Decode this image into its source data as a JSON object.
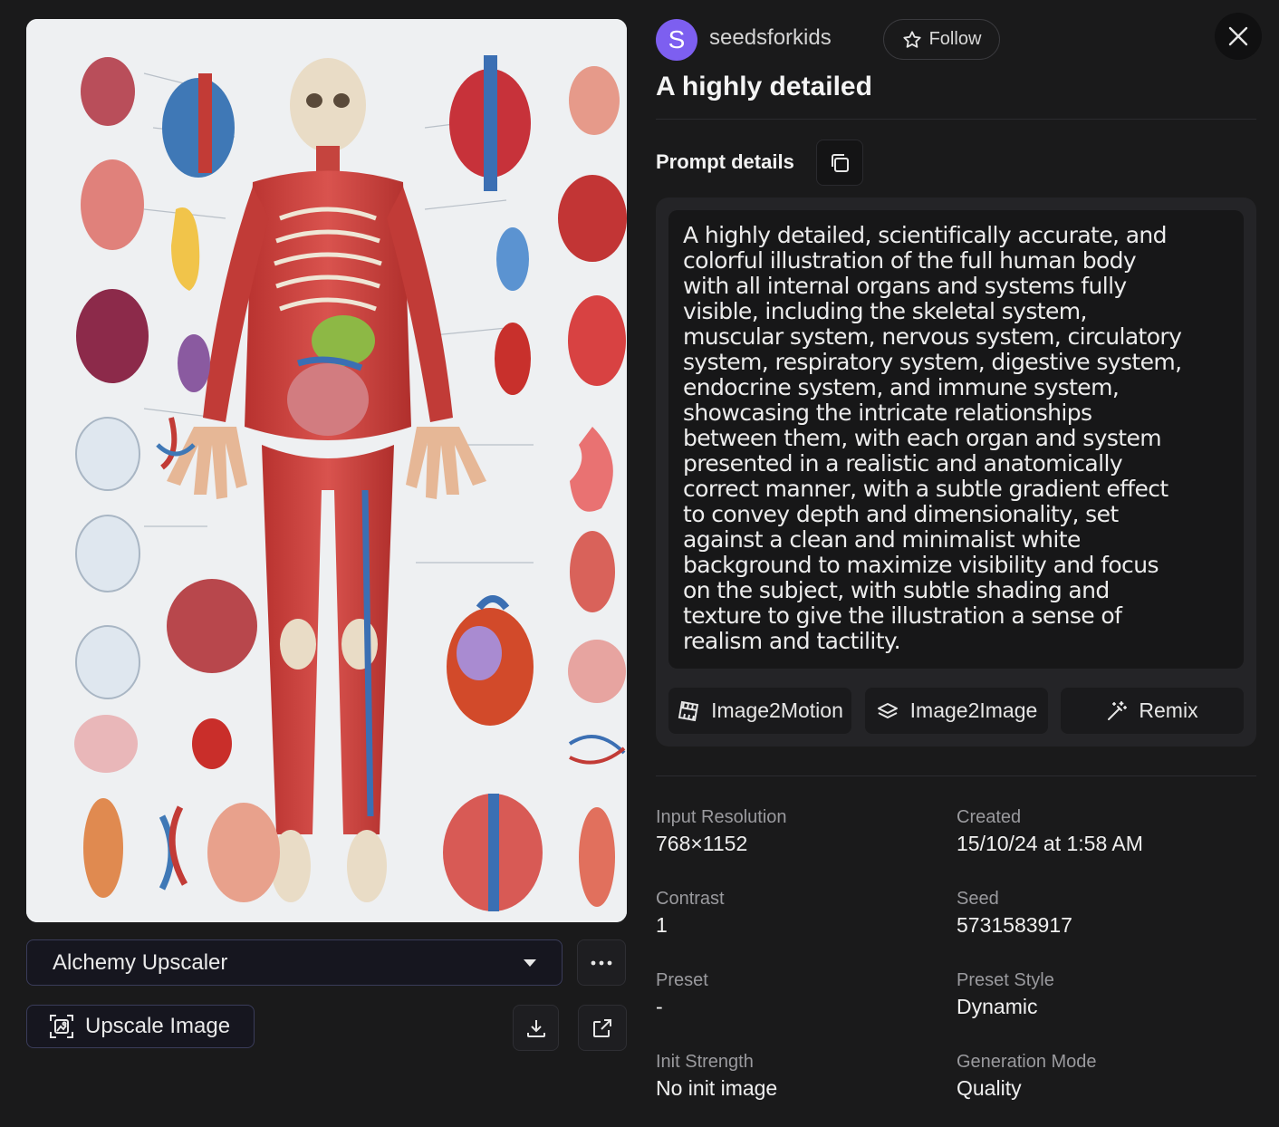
{
  "user": {
    "avatar_letter": "S",
    "name": "seedsforkids",
    "follow_label": "Follow"
  },
  "title": "A highly detailed",
  "prompt": {
    "heading": "Prompt details",
    "lines": [
      "A highly detailed, scientifically accurate, and",
      "colorful illustration of the full human body",
      "with all internal organs and systems fully",
      "visible, including the skeletal system,",
      "muscular system, nervous system, circulatory",
      "system, respiratory system, digestive system,",
      "endocrine system, and immune system,",
      "showcasing the intricate relationships",
      "between them, with each organ and system",
      "presented in a realistic and anatomically",
      "correct manner, with a subtle gradient effect",
      "to convey depth and dimensionality, set",
      "against a clean and minimalist white",
      "background to maximize visibility and focus",
      "on the subject, with subtle shading and",
      "texture to give the illustration a sense of",
      "realism and tactility."
    ]
  },
  "actions": {
    "motion": "Image2Motion",
    "image2image": "Image2Image",
    "remix": "Remix"
  },
  "upscaler": {
    "selected": "Alchemy Upscaler",
    "upscale_label": "Upscale Image"
  },
  "meta": {
    "input_resolution": {
      "label": "Input Resolution",
      "value": "768×1152"
    },
    "created": {
      "label": "Created",
      "value": "15/10/24 at 1:58 AM"
    },
    "contrast": {
      "label": "Contrast",
      "value": "1"
    },
    "seed": {
      "label": "Seed",
      "value": "5731583917"
    },
    "preset": {
      "label": "Preset",
      "value": "-"
    },
    "preset_style": {
      "label": "Preset Style",
      "value": "Dynamic"
    },
    "init_strength": {
      "label": "Init Strength",
      "value": "No init image"
    },
    "generation_mode": {
      "label": "Generation Mode",
      "value": "Quality"
    }
  },
  "icons": {
    "close": "close-icon",
    "follow": "star-icon",
    "copy": "copy-icon",
    "motion": "film-icon",
    "image2image": "layers-icon",
    "remix": "magic-wand-icon",
    "more": "more-horizontal-icon",
    "upscale": "upscale-icon",
    "download": "download-icon",
    "share": "external-link-icon"
  },
  "colors": {
    "background": "#1a1a1b",
    "avatar": "#7d5ff0",
    "card": "#242427",
    "muted_text": "#9a9a9e"
  }
}
